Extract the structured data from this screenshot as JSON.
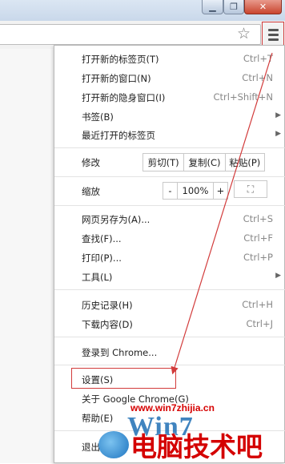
{
  "menu": {
    "new_tab": {
      "label": "打开新的标签页(T)",
      "shortcut": "Ctrl+T"
    },
    "new_window": {
      "label": "打开新的窗口(N)",
      "shortcut": "Ctrl+N"
    },
    "incognito": {
      "label": "打开新的隐身窗口(I)",
      "shortcut": "Ctrl+Shift+N"
    },
    "bookmarks": {
      "label": "书签(B)"
    },
    "recent_tabs": {
      "label": "最近打开的标签页"
    },
    "edit": {
      "label": "修改",
      "cut": "剪切(T)",
      "copy": "复制(C)",
      "paste": "粘贴(P)"
    },
    "zoom": {
      "label": "缩放",
      "minus": "-",
      "value": "100%",
      "plus": "+"
    },
    "save_as": {
      "label": "网页另存为(A)...",
      "shortcut": "Ctrl+S"
    },
    "find": {
      "label": "查找(F)...",
      "shortcut": "Ctrl+F"
    },
    "print": {
      "label": "打印(P)...",
      "shortcut": "Ctrl+P"
    },
    "tools": {
      "label": "工具(L)"
    },
    "history": {
      "label": "历史记录(H)",
      "shortcut": "Ctrl+H"
    },
    "downloads": {
      "label": "下载内容(D)",
      "shortcut": "Ctrl+J"
    },
    "signin": {
      "label": "登录到 Chrome..."
    },
    "settings": {
      "label": "设置(S)"
    },
    "about": {
      "label": "关于 Google Chrome(G)"
    },
    "help": {
      "label": "帮助(E)"
    },
    "exit": {
      "label": "退出(X)"
    }
  },
  "watermark": {
    "url": "www.win7zhijia.cn",
    "logo": "Win7",
    "text": "电脑技术吧"
  },
  "colors": {
    "highlight": "#d23b3b",
    "watermark_red": "#d40000"
  }
}
